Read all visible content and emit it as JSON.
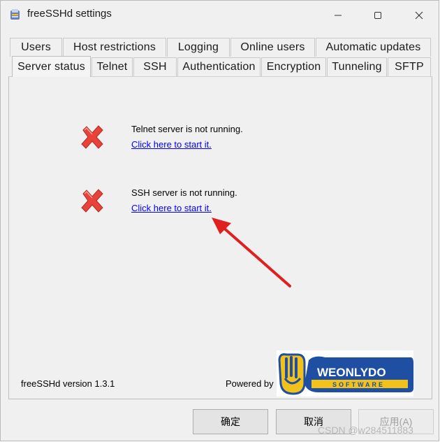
{
  "window": {
    "title": "freeSSHd settings",
    "controls": [
      "minimize-icon",
      "maximize-icon",
      "close-icon"
    ]
  },
  "tabs": {
    "row1": [
      "Users",
      "Host restrictions",
      "Logging",
      "Online users",
      "Automatic updates"
    ],
    "row2": [
      "Server status",
      "Telnet",
      "SSH",
      "Authentication",
      "Encryption",
      "Tunneling",
      "SFTP"
    ],
    "active": "Server status"
  },
  "server_status": {
    "telnet": {
      "message": "Telnet server is not running.",
      "link": "Click here to start it.",
      "icon": "red-x-icon"
    },
    "ssh": {
      "message": "SSH server is not running.",
      "link": "Click here to start it.",
      "icon": "red-x-icon"
    },
    "version": "freeSSHd version 1.3.1",
    "powered_by": "Powered by",
    "logo": {
      "main": "WEONLYDO",
      "sub": "SOFTWARE"
    }
  },
  "buttons": {
    "ok": "确定",
    "cancel": "取消",
    "apply": "应用(A)"
  },
  "watermark": "CSDN @w284511883",
  "colors": {
    "link": "#0000ff",
    "x_red": "#e8423a",
    "arrow": "#e02020",
    "logo_blue": "#1f4fa3",
    "logo_yellow": "#f2c21b"
  }
}
